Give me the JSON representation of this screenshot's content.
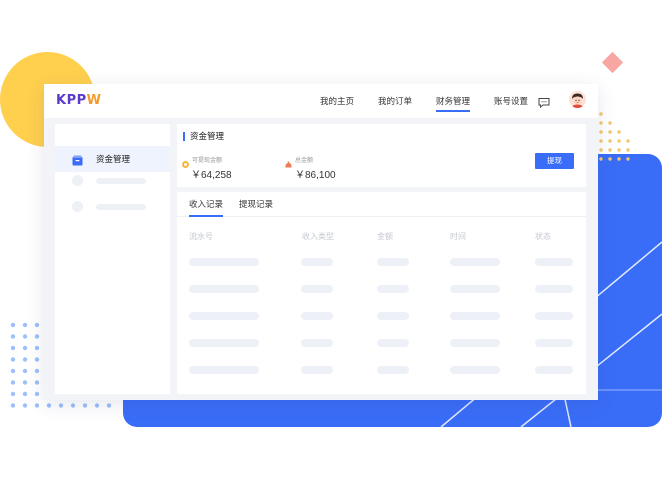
{
  "brand": {
    "logo_main": "KPP",
    "logo_accent": "W"
  },
  "nav": {
    "items": [
      {
        "label": "我的主页",
        "active": false
      },
      {
        "label": "我的订单",
        "active": false
      },
      {
        "label": "财务管理",
        "active": true
      },
      {
        "label": "账号设置",
        "active": false
      }
    ],
    "message_icon": "message-icon",
    "avatar_icon": "avatar"
  },
  "sidebar": {
    "active_item": {
      "label": "资金管理",
      "icon": "wallet-icon"
    }
  },
  "finance": {
    "title": "资金管理",
    "withdrawable": {
      "label": "可提现金额",
      "value": "￥64,258",
      "icon_color": "#F3B53C"
    },
    "total": {
      "label": "总金额",
      "value": "￥86,100",
      "icon_color": "#F27B52"
    },
    "withdraw_button": "提现"
  },
  "records": {
    "tabs": [
      {
        "label": "收入记录",
        "active": true
      },
      {
        "label": "提现记录",
        "active": false
      }
    ],
    "columns": [
      "流水号",
      "收入类型",
      "金额",
      "时间",
      "状态"
    ]
  },
  "colors": {
    "accent": "#3A6DF7",
    "yellow": "#FFD04E",
    "pink": "#F7A6A1",
    "brand_purple": "#5A3BC9",
    "brand_orange": "#F39A2C"
  }
}
